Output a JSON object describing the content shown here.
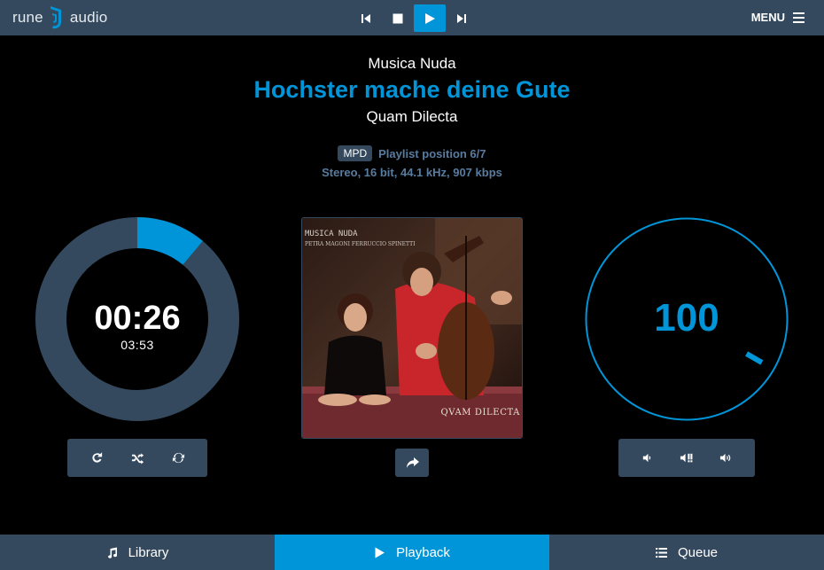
{
  "header": {
    "logo_left": "rune",
    "logo_right": "audio",
    "menu_label": "MENU",
    "transport": [
      {
        "id": "previous",
        "icon": "previous-icon",
        "active": false
      },
      {
        "id": "stop",
        "icon": "stop-icon",
        "active": false
      },
      {
        "id": "play",
        "icon": "play-icon",
        "active": true
      },
      {
        "id": "next",
        "icon": "next-icon",
        "active": false
      }
    ]
  },
  "track": {
    "artist": "Musica Nuda",
    "title": "Hochster mache deine Gute",
    "album": "Quam Dilecta",
    "source_badge": "MPD",
    "playlist_position": "Playlist position 6/7",
    "format": "Stereo, 16 bit, 44.1 kHz, 907 kbps"
  },
  "playback": {
    "elapsed": "00:26",
    "total": "03:53",
    "progress_fraction": 0.111
  },
  "cover": {
    "title": "MUSICA NUDA",
    "subtitle": "PETRA MAGONI  FERRUCCIO SPINETTI",
    "album": "QVAM DILECTA"
  },
  "volume": {
    "value": "100"
  },
  "controls": {
    "playback_modes": [
      "repeat-icon",
      "shuffle-icon",
      "refresh-icon"
    ],
    "volume_buttons": [
      "volume-down-icon",
      "mute-icon",
      "volume-up-icon"
    ]
  },
  "tabs": [
    {
      "label": "Library",
      "icon": "music-note-icon",
      "active": false
    },
    {
      "label": "Playback",
      "icon": "play-icon",
      "active": true
    },
    {
      "label": "Queue",
      "icon": "list-icon",
      "active": false
    }
  ],
  "colors": {
    "accent": "#0095d8",
    "panel": "#34495e",
    "muted_text": "#587ca0",
    "background": "#000000"
  }
}
